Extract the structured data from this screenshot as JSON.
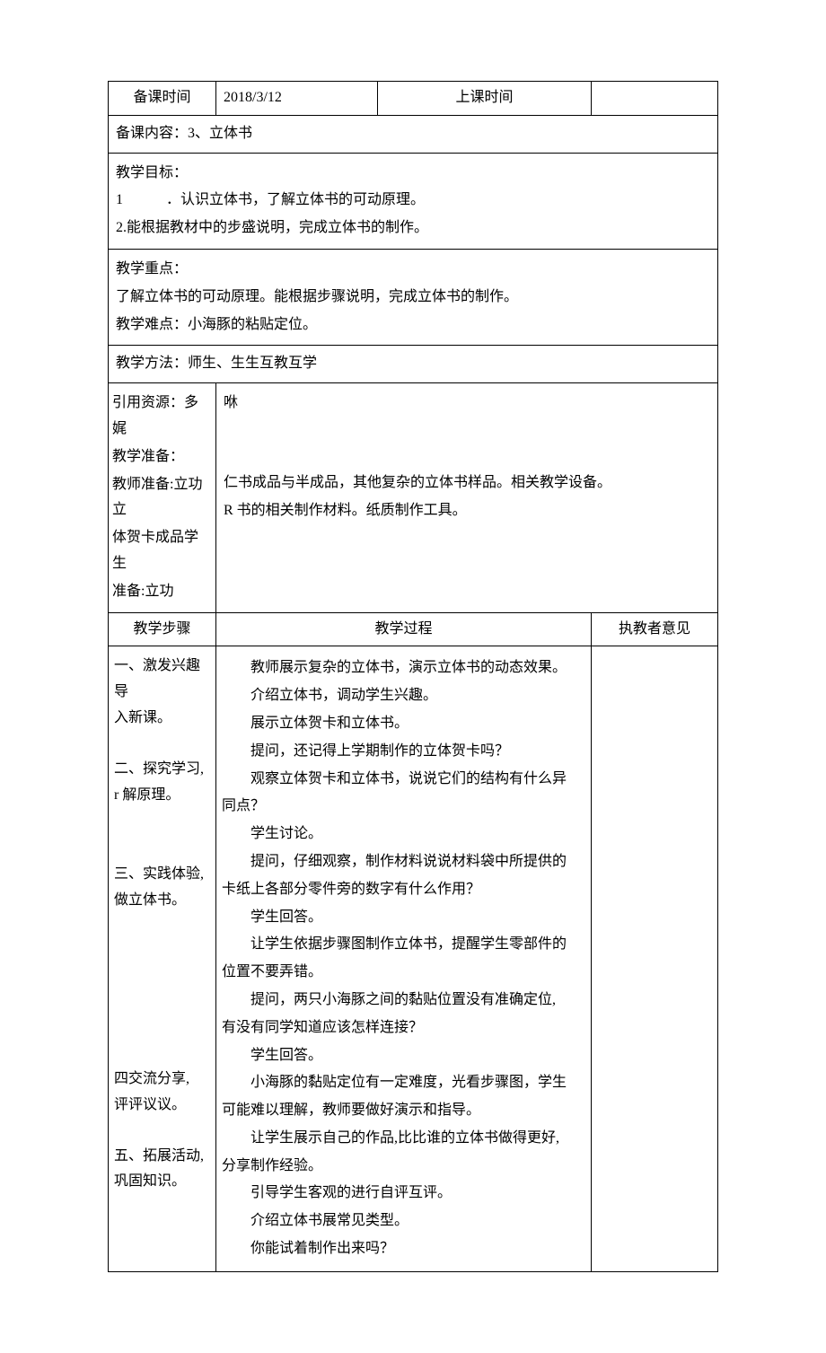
{
  "top": {
    "prep_time_label": "备课时间",
    "prep_time_value": "2018/3/12",
    "class_time_label": "上课时间",
    "class_time_value": ""
  },
  "content_line": "备课内容：3、立体书",
  "goals": {
    "title": "教学目标：",
    "g1_num": "1",
    "g1_text": "．认识立体书，了解立体书的可动原理。",
    "g2": "2.能根据教材中的步盛说明，完成立体书的制作。"
  },
  "focus": {
    "title": "教学重点：",
    "l1": "了解立体书的可动原理。能根据步骤说明，完成立体书的制作。",
    "l2": "教学难点：小海豚的粘贴定位。"
  },
  "method": "教学方法：师生、生生互教互学",
  "prep": {
    "left": {
      "l1": "引用资源：多娓",
      "l2": "教学准备：",
      "l3": "教师准备:立功立",
      "l4": "体贺卡成品学生",
      "l5": "准备:立功"
    },
    "right": {
      "r1": "咻",
      "r2": "仁书成品与半成品，其他复杂的立体书样品。相关教学设备。",
      "r3": "R 书的相关制作材料。纸质制作工具。"
    }
  },
  "headers": {
    "step": "教学步骤",
    "proc": "教学过程",
    "op": "执教者意见"
  },
  "steps": {
    "s1a": "一、激发兴趣导",
    "s1b": "入新课。",
    "s2a": "二、探究学习,",
    "s2b": "r 解原理。",
    "s3a": "三、实践体验,",
    "s3b": "做立体书。",
    "s4a": "四交流分享,",
    "s4b": "评评议议。",
    "s5a": "五、拓展活动,",
    "s5b": "巩固知识。"
  },
  "proc": {
    "p1": "教师展示复杂的立体书，演示立体书的动态效果。",
    "p2": "介绍立体书，调动学生兴趣。",
    "p3": "展示立体贺卡和立体书。",
    "p4": "提问，还记得上学期制作的立体贺卡吗？",
    "p5a": "观察立体贺卡和立体书，说说它们的结构有什么异",
    "p5b": "同点？",
    "p6": "学生讨论。",
    "p7a": "提问，仔细观察，制作材料说说材料袋中所提供的",
    "p7b": "卡纸上各部分零件旁的数字有什么作用？",
    "p8": "学生回答。",
    "p9a": "让学生依据步骤图制作立体书，提醒学生零部件的",
    "p9b": "位置不要弄错。",
    "p10a": "提问，两只小海豚之间的黏贴位置没有准确定位,",
    "p10b": "有没有同学知道应该怎样连接？",
    "p11": "学生回答。",
    "p12a": "小海豚的黏贴定位有一定难度，光看步骤图，学生",
    "p12b": "可能难以理解，教师要做好演示和指导。",
    "p13a": "让学生展示自己的作品,比比谁的立体书做得更好,",
    "p13b": "分享制作经验。",
    "p14": "引导学生客观的进行自评互评。",
    "p15": "介绍立体书展常见类型。",
    "p16": "你能试着制作出来吗？"
  }
}
